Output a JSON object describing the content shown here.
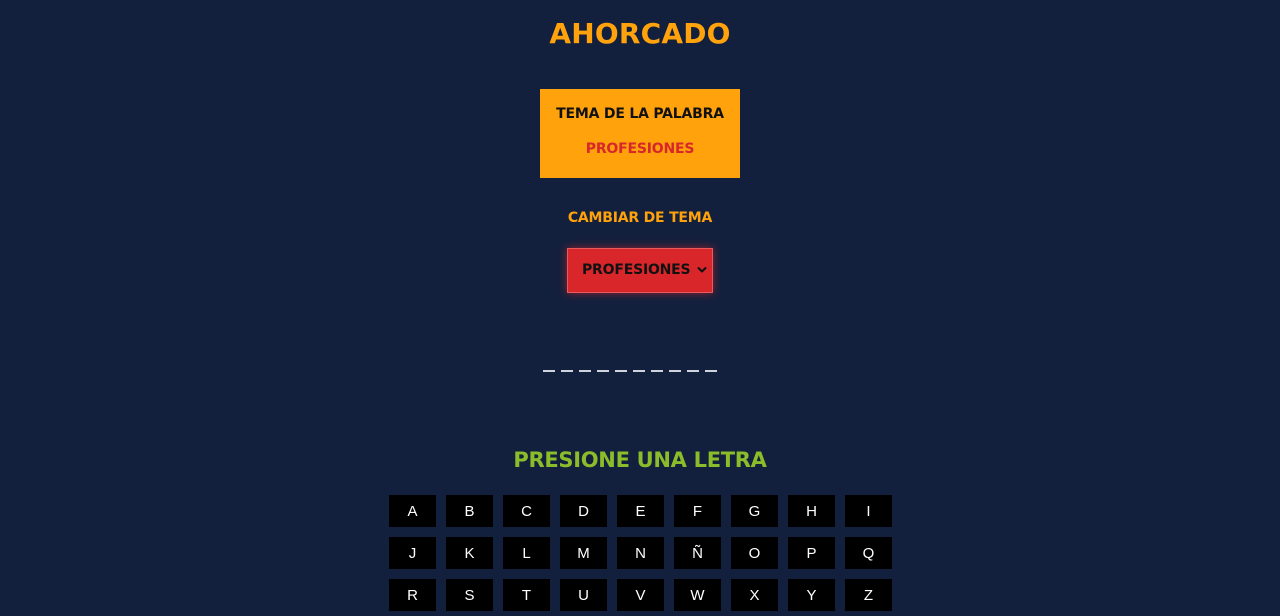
{
  "header": {
    "title": "AHORCADO"
  },
  "theme": {
    "label": "TEMA DE LA PALABRA",
    "value": "PROFESIONES"
  },
  "change_theme": {
    "label": "CAMBIAR DE TEMA",
    "selected": "PROFESIONES"
  },
  "word": {
    "hidden_letters": 10
  },
  "prompt": {
    "text": "PRESIONE UNA LETRA"
  },
  "keyboard": {
    "keys": [
      "A",
      "B",
      "C",
      "D",
      "E",
      "F",
      "G",
      "H",
      "I",
      "J",
      "K",
      "L",
      "M",
      "N",
      "Ñ",
      "O",
      "P",
      "Q",
      "R",
      "S",
      "T",
      "U",
      "V",
      "W",
      "X",
      "Y",
      "Z"
    ]
  },
  "colors": {
    "background": "#13203d",
    "accent_orange": "#ffa20c",
    "accent_red": "#d8262a",
    "prompt_green": "#8bbc2a"
  }
}
